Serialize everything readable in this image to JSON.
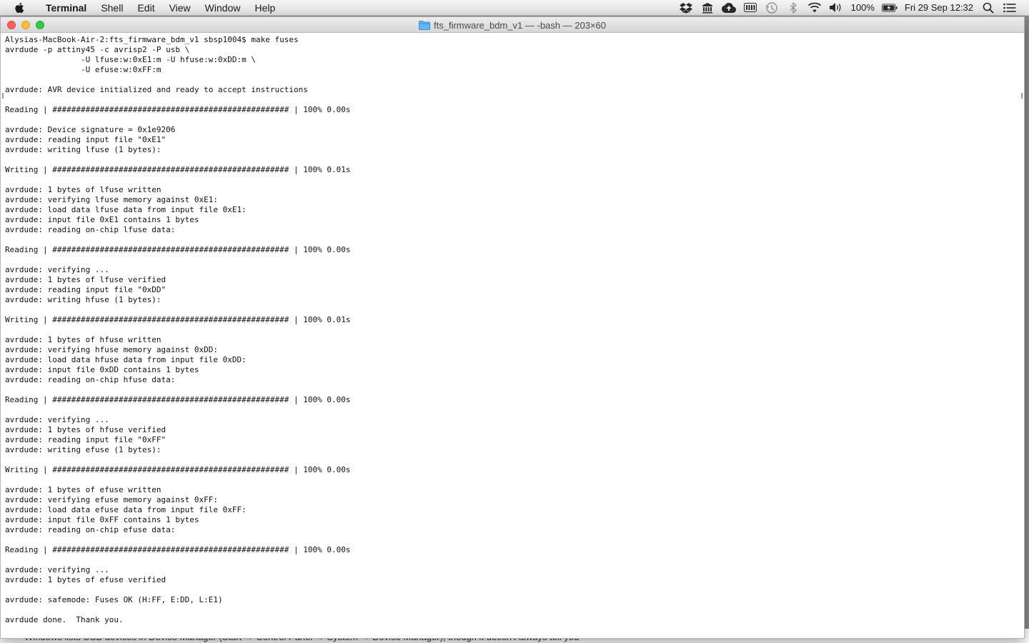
{
  "menubar": {
    "app_name": "Terminal",
    "items": [
      "Shell",
      "Edit",
      "View",
      "Window",
      "Help"
    ],
    "battery_percent": "100%",
    "datetime": "Fri 29 Sep  12:32",
    "icons": [
      "apple-icon",
      "dropbox-icon",
      "bank-icon",
      "cloud-upload-icon",
      "memory-icon",
      "time-machine-icon",
      "bluetooth-icon",
      "wifi-icon",
      "volume-icon",
      "battery-icon",
      "spotlight-icon",
      "notification-center-icon"
    ]
  },
  "window": {
    "title": "fts_firmware_bdm_v1 — -bash — 203×60",
    "folder_icon": "folder-icon"
  },
  "background": {
    "text": "Windows lists USB devices in Device Manager (Start → Control Panel → System → Device Manager), though it doesn't always tell you"
  },
  "terminal": {
    "lines": [
      "Alysias-MacBook-Air-2:fts_firmware_bdm_v1 sbsp1004$ make fuses",
      "avrdude -p attiny45 -c avrisp2 -P usb \\",
      "                -U lfuse:w:0xE1:m -U hfuse:w:0xDD:m \\",
      "                -U efuse:w:0xFF:m",
      "",
      "avrdude: AVR device initialized and ready to accept instructions",
      "",
      "Reading | ################################################## | 100% 0.00s",
      "",
      "avrdude: Device signature = 0x1e9206",
      "avrdude: reading input file \"0xE1\"",
      "avrdude: writing lfuse (1 bytes):",
      "",
      "Writing | ################################################## | 100% 0.01s",
      "",
      "avrdude: 1 bytes of lfuse written",
      "avrdude: verifying lfuse memory against 0xE1:",
      "avrdude: load data lfuse data from input file 0xE1:",
      "avrdude: input file 0xE1 contains 1 bytes",
      "avrdude: reading on-chip lfuse data:",
      "",
      "Reading | ################################################## | 100% 0.00s",
      "",
      "avrdude: verifying ...",
      "avrdude: 1 bytes of lfuse verified",
      "avrdude: reading input file \"0xDD\"",
      "avrdude: writing hfuse (1 bytes):",
      "",
      "Writing | ################################################## | 100% 0.01s",
      "",
      "avrdude: 1 bytes of hfuse written",
      "avrdude: verifying hfuse memory against 0xDD:",
      "avrdude: load data hfuse data from input file 0xDD:",
      "avrdude: input file 0xDD contains 1 bytes",
      "avrdude: reading on-chip hfuse data:",
      "",
      "Reading | ################################################## | 100% 0.00s",
      "",
      "avrdude: verifying ...",
      "avrdude: 1 bytes of hfuse verified",
      "avrdude: reading input file \"0xFF\"",
      "avrdude: writing efuse (1 bytes):",
      "",
      "Writing | ################################################## | 100% 0.00s",
      "",
      "avrdude: 1 bytes of efuse written",
      "avrdude: verifying efuse memory against 0xFF:",
      "avrdude: load data efuse data from input file 0xFF:",
      "avrdude: input file 0xFF contains 1 bytes",
      "avrdude: reading on-chip efuse data:",
      "",
      "Reading | ################################################## | 100% 0.00s",
      "",
      "avrdude: verifying ...",
      "avrdude: 1 bytes of efuse verified",
      "",
      "avrdude: safemode: Fuses OK (H:FF, E:DD, L:E1)",
      "",
      "avrdude done.  Thank you.",
      ""
    ]
  }
}
